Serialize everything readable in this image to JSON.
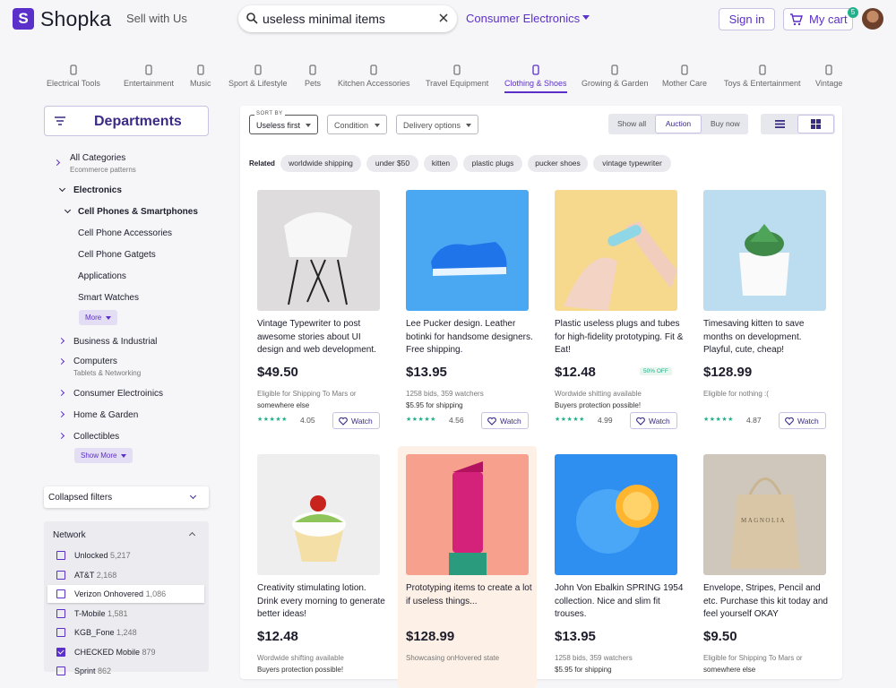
{
  "header": {
    "logo_letter": "S",
    "logo_text": "Shopka",
    "sell_link": "Sell with Us",
    "search_value": "useless minimal items",
    "category": "Consumer Electronics",
    "sign_in": "Sign in",
    "cart_label": "My cart",
    "cart_count": "5"
  },
  "categories": [
    {
      "label": "Electrical Tools",
      "icon": "plug-icon"
    },
    {
      "label": "Entertainment",
      "icon": "film-icon"
    },
    {
      "label": "Music",
      "icon": "music-note-icon"
    },
    {
      "label": "Sport & Lifestyle",
      "icon": "sport-icon"
    },
    {
      "label": "Pets",
      "icon": "bone-icon"
    },
    {
      "label": "Kitchen Accessories",
      "icon": "utensils-icon"
    },
    {
      "label": "Travel Equipment",
      "icon": "suitcase-icon"
    },
    {
      "label": "Clothing & Shoes",
      "icon": "hanger-icon",
      "active": true
    },
    {
      "label": "Growing & Garden",
      "icon": "plant-icon"
    },
    {
      "label": "Mother Care",
      "icon": "stroller-icon"
    },
    {
      "label": "Toys & Entertainment",
      "icon": "toy-icon"
    },
    {
      "label": "Vintage",
      "icon": "vintage-icon"
    }
  ],
  "sidebar": {
    "departments": "Departments",
    "all_categories": "All Categories",
    "all_categories_sub": "Ecommerce patterns",
    "electronics": "Electronics",
    "cell_phones": "Cell Phones & Smartphones",
    "cell_items": [
      "Cell Phone Accessories",
      "Cell Phone Gatgets",
      "Applications",
      "Smart Watches"
    ],
    "more": "More",
    "business": "Business & Industrial",
    "computers": "Computers",
    "computers_sub": "Tablets & Networking",
    "consumer": "Consumer Electroinics",
    "home": "Home & Garden",
    "collectibles": "Collectibles",
    "show_more": "Show More",
    "collapsed_filters": "Collapsed filters",
    "network_title": "Network",
    "network": [
      {
        "name": "Unlocked",
        "count": "5,217",
        "checked": false
      },
      {
        "name": "AT&T",
        "count": "2,168",
        "checked": false
      },
      {
        "name": "Verizon Onhovered",
        "count": "1,086",
        "checked": false,
        "hover": true
      },
      {
        "name": "T-Mobile",
        "count": "1,581",
        "checked": false
      },
      {
        "name": "KGB_Fone",
        "count": "1,248",
        "checked": false
      },
      {
        "name": "CHECKED Mobile",
        "count": "879",
        "checked": true
      },
      {
        "name": "Sprint",
        "count": "862",
        "checked": false
      }
    ]
  },
  "toolbar": {
    "sort_legend": "SORT BY",
    "sort_value": "Useless first",
    "condition": "Condition",
    "delivery": "Delivery options",
    "seg_all": "Show all",
    "seg_auction": "Auction",
    "seg_buy": "Buy now"
  },
  "related": {
    "label": "Related",
    "chips": [
      "worldwide shipping",
      "under $50",
      "kitten",
      "plastic plugs",
      "pucker shoes",
      "vintage typewriter"
    ]
  },
  "products": [
    {
      "title": "Vintage Typewriter to post awesome stories about UI design and web development.",
      "price": "$49.50",
      "desc1": "Eligible for Shipping To Mars or",
      "desc2": "somewhere else",
      "stars": "★★★★★",
      "rating": "4.05",
      "watch": "Watch",
      "image": "chair"
    },
    {
      "title": "Lee Pucker design. Leather botinki for handsome designers. Free shipping.",
      "price": "$13.95",
      "desc1": "1258 bids, 359 watchers",
      "desc2": "$5.95 for shipping",
      "stars": "★★★★★",
      "rating": "4.56",
      "watch": "Watch",
      "image": "shoe"
    },
    {
      "title": "Plastic useless plugs and tubes for high-fidelity prototyping. Fit & Eat!",
      "price": "$12.48",
      "badge": "50% OFF",
      "desc1": "Wordwide shitting available",
      "desc2": "Buyers protection possible!",
      "stars": "★★★★★",
      "rating": "4.99",
      "watch": "Watch",
      "image": "hands"
    },
    {
      "title": "Timesaving kitten to save months on development. Playful, cute, cheap!",
      "price": "$128.99",
      "desc1": "Eligible for nothing :(",
      "desc2": "",
      "stars": "★★★★★",
      "rating": "4.87",
      "watch": "Watch",
      "image": "plant"
    },
    {
      "title": "Creativity stimulating lotion. Drink every morning to generate better ideas!",
      "price": "$12.48",
      "desc1": "Wordwide shifting available",
      "desc2": "Buyers protection possible!",
      "image": "cupcake"
    },
    {
      "title": "Prototyping items to create a lot if useless things...",
      "price": "$128.99",
      "desc1": "Showcasing onHovered state",
      "desc2": "",
      "image": "lipstick",
      "hovered": true
    },
    {
      "title": "John Von Ebalkin SPRING 1954 collection. Nice and slim fit trouses.",
      "price": "$13.95",
      "desc1": "1258 bids, 359 watchers",
      "desc2": "$5.95 for shipping",
      "image": "orange"
    },
    {
      "title": "Envelope, Stripes, Pencil and etc. Purchase this kit today and feel yourself OKAY",
      "price": "$9.50",
      "desc1": "Eligible for Shipping To Mars or",
      "desc2": "somewhere else",
      "image": "bag",
      "bag_text": "MAGNOLIA"
    }
  ],
  "colors": {
    "brand": "#5b2fc9",
    "accent_green": "#21b08a"
  }
}
